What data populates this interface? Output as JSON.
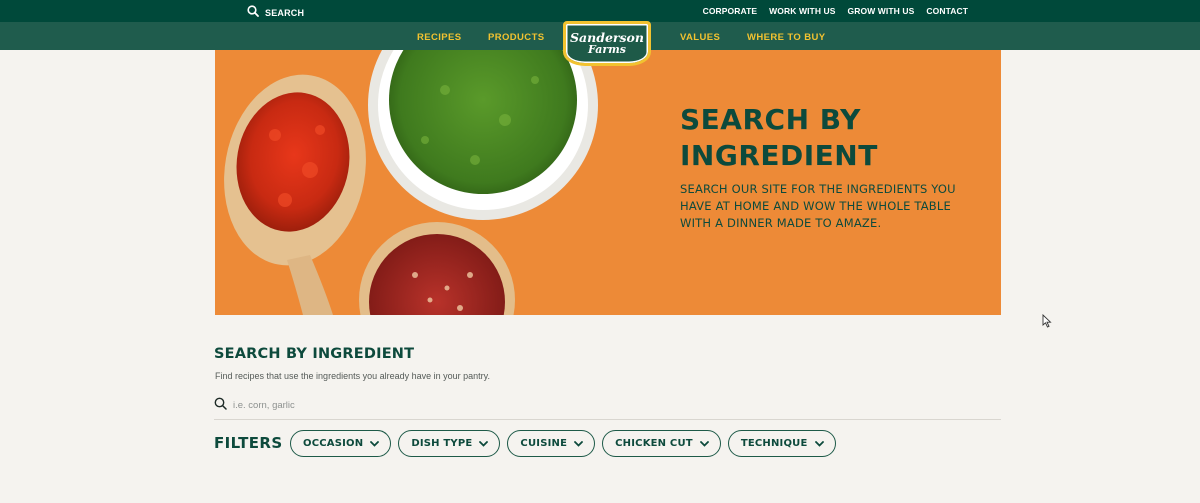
{
  "topbar": {
    "search_label": "SEARCH",
    "links": [
      "CORPORATE",
      "WORK WITH US",
      "GROW WITH US",
      "CONTACT"
    ]
  },
  "nav": {
    "items": [
      "RECIPES",
      "PRODUCTS",
      "VALUES",
      "WHERE TO BUY"
    ],
    "logo": {
      "line1": "Sanderson",
      "line2": "Farms"
    }
  },
  "hero": {
    "title": "SEARCH BY INGREDIENT",
    "description": "SEARCH OUR SITE FOR THE INGREDIENTS YOU HAVE AT HOME AND WOW THE WHOLE TABLE WITH A DINNER MADE TO AMAZE."
  },
  "ingredient_search": {
    "title": "SEARCH BY INGREDIENT",
    "description": "Find recipes that use the ingredients you already have in your pantry.",
    "placeholder": "i.e. corn, garlic",
    "value": ""
  },
  "filters": {
    "label": "FILTERS",
    "options": [
      "OCCASION",
      "DISH TYPE",
      "CUISINE",
      "CHICKEN CUT",
      "TECHNIQUE"
    ]
  },
  "colors": {
    "dark_green": "#00493a",
    "nav_green": "#1f5c4d",
    "gold": "#f2c230",
    "hero_orange": "#ed8a37",
    "text_green": "#0d4a3c",
    "page_bg": "#f5f3ef"
  },
  "icons": [
    "search-icon",
    "chevron-down-icon",
    "cursor-arrow"
  ]
}
